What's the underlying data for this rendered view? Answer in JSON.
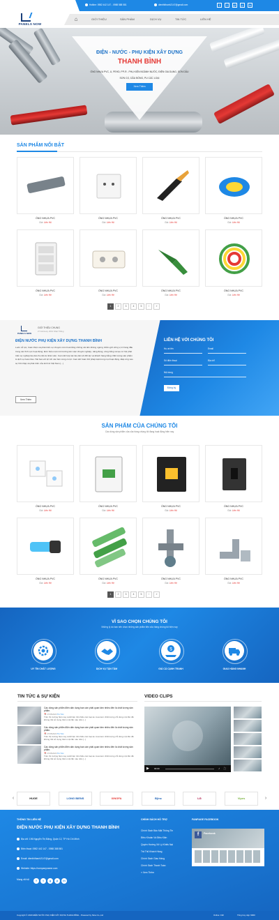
{
  "colors": {
    "accent": "#1e88e5",
    "accent_dark": "#1565c0",
    "price_red": "#e53935",
    "title_red": "#e53935"
  },
  "topbar": {
    "hotline": "Hotline: 0982 442 147 - 0988 588 581",
    "email": "dienthithanh2147@gmail.com",
    "social_icons": [
      "f",
      "t",
      "g+",
      "p",
      "in"
    ]
  },
  "logo": {
    "text": "PANELS NOW"
  },
  "nav": {
    "home_icon": "home-icon",
    "items": [
      "GIỚI THIỆU",
      "SẢN PHẨM",
      "DỊCH VỤ",
      "TIN TỨC",
      "LIÊN HỆ"
    ]
  },
  "banner": {
    "title1": "ĐIỆN - NƯỚC - PHỤ KIỆN XÂY DỰNG",
    "title2": "THANH BÌNH",
    "desc1": "ỐNG NHỰA PVC, U, PEHD, PP-R - PHỤ KIỆN NGÀNH NƯỚC, ĐIỆN GIA DỤNG, SƠN DẦU",
    "desc2": "SƠN CỌ, DẦU BÓNG, PU CÁC LOẠI",
    "button": "Xem Thêm"
  },
  "featured": {
    "title": "SẢN PHẨM NỔI BẬT",
    "products": [
      {
        "name": "ỐNG NHỰA PVC",
        "price_label": "Giá:",
        "price": "Liên Hệ",
        "image": "grey-pvc-pipe"
      },
      {
        "name": "ỐNG NHỰA PVC",
        "price_label": "Giá:",
        "price": "Liên Hệ",
        "image": "wall-socket"
      },
      {
        "name": "ỐNG NHỰA PVC",
        "price_label": "Giá:",
        "price": "Liên Hệ",
        "image": "wire-stripper-tool"
      },
      {
        "name": "ỐNG NHỰA PVC",
        "price_label": "Giá:",
        "price": "Liên Hệ",
        "image": "cable-coil"
      },
      {
        "name": "ỐNG NHỰA PVC",
        "price_label": "Giá:",
        "price": "Liên Hệ",
        "image": "light-switch"
      },
      {
        "name": "ỐNG NHỰA PVC",
        "price_label": "Giá:",
        "price": "Liên Hệ",
        "image": "power-socket-box"
      },
      {
        "name": "ỐNG NHỰA PVC",
        "price_label": "Giá:",
        "price": "Liên Hệ",
        "image": "green-pipe-cutter"
      },
      {
        "name": "ỐNG NHỰA PVC",
        "price_label": "Giá:",
        "price": "Liên Hệ",
        "image": "colored-wire-bundle"
      }
    ],
    "pager": [
      "1",
      "2",
      "3",
      "4",
      "5",
      "›",
      "»"
    ]
  },
  "intro": {
    "subtitle": "GIỚI THIỆU CHUNG",
    "date": "27 February 2019 Nhật Thắng",
    "title": "ĐIỆN NƯỚC PHỤ KIỆN XÂY DỰNG THANH BÌNH",
    "text": "Luôn nỗ lực, hoàn thiện và phát triển sự chuyên môn hoá bằng những cải tiến không ngừng nhằm giữ vững vị trí hàng đầu trong các lĩnh vực hoạt động. Đơn hiểu một môi trường làm việc chuyên nghiệp, năng động, công bằng và tạo cơ hội phát triển sự nghiệp lâu dài cho tất cả nhân viên. Cam kết hợp tác lâu dài với đối tác và khách hàng bằng chất lượng sản phẩm & dịch vụ hoàn hảo. Hài hoà với lợi ích các bên cùng có lợi. Cam kết hoàn thủ pháp luật trong mọi hoạt động. Đáp ứng vào sự hồi nhập và phát triển của kinh tế Việt Nam [...]",
    "button": "Xem Thêm"
  },
  "contact": {
    "title": "LIÊN HỆ VỚI CHÚNG TÔI",
    "fields": [
      {
        "label": "Họ và tên"
      },
      {
        "label": "Email"
      },
      {
        "label": "Số điện thoại"
      },
      {
        "label": "Địa chỉ"
      },
      {
        "label": "Nội dung"
      }
    ],
    "button": "Đăng ký"
  },
  "products": {
    "title": "SẢN PHẨM CỦA CHÚNG TÔI",
    "subtitle": "Các dòng sản phẩm của của hàng chúng tôi đang hoạt động hiện nay",
    "items": [
      {
        "name": "ỐNG NHỰA PVC",
        "price_label": "Giá:",
        "price": "Liên Hệ",
        "image": "touch-switch-panels"
      },
      {
        "name": "ỐNG NHỰA PVC",
        "price_label": "Giá:",
        "price": "Liên Hệ",
        "image": "circuit-breaker"
      },
      {
        "name": "ỐNG NHỰA PVC",
        "price_label": "Giá:",
        "price": "Liên Hệ",
        "image": "mccb-breaker"
      },
      {
        "name": "ỐNG NHỰA PVC",
        "price_label": "Giá:",
        "price": "Liên Hệ",
        "image": "black-switch-box"
      },
      {
        "name": "ỐNG NHỰA PVC",
        "price_label": "Giá:",
        "price": "Liên Hệ",
        "image": "hose-connector"
      },
      {
        "name": "ỐNG NHỰA PVC",
        "price_label": "Giá:",
        "price": "Liên Hệ",
        "image": "green-ppr-pipes"
      },
      {
        "name": "ỐNG NHỰA PVC",
        "price_label": "Giá:",
        "price": "Liên Hệ",
        "image": "grey-pipe-fittings"
      },
      {
        "name": "ỐNG NHỰA PVC",
        "price_label": "Giá:",
        "price": "Liên Hệ",
        "image": "elbow-fittings"
      }
    ],
    "pager": [
      "1",
      "2",
      "3",
      "4",
      "5",
      "›",
      "»"
    ]
  },
  "why": {
    "title": "VÌ SAO CHỌN CHÚNG TÔI",
    "subtitle": "Những lý do bạn nên chọn những sản phẩm tiện của hàng chúng tôi hiện nay",
    "items": [
      {
        "label": "UY TÍN CHẤT LƯỢNG",
        "icon": "quality-gear-icon"
      },
      {
        "label": "DỊCH VỤ TẬN TÂM",
        "icon": "handshake-icon"
      },
      {
        "label": "GIÁ CẢ CẠNH TRANH",
        "icon": "money-hand-icon"
      },
      {
        "label": "GIAO HÀNG NHANH",
        "icon": "delivery-truck-icon"
      }
    ]
  },
  "news": {
    "title": "TIN TỨC & SỰ KIỆN",
    "items": [
      {
        "headline": "Các dòng sản phẩm điện dân dụng bạn cần phải quan tâm nhiều đến là chất lượng sản phẩm.",
        "date": "27/05/2020",
        "tag": "Tin Tức",
        "excerpt": "Trên thị trường hiện nay xuất hiện rất nhiều các loại ào mua kém chất lượng chỉ dùng một lần đã không thể sử dụng thêm một lần nào nữa [...]"
      },
      {
        "headline": "Các dòng sản phẩm điện dân dụng bạn cần phải quan tâm nhiều đến là chất lượng sản phẩm.",
        "date": "27/05/2020",
        "tag": "Tin Tức",
        "excerpt": "Trên thị trường hiện nay xuất hiện rất nhiều các loại ào mua kém chất lượng chỉ dùng một lần đã không thể sử dụng thêm một lần nào nữa [...]"
      },
      {
        "headline": "Các dòng sản phẩm điện dân dụng bạn cần phải quan tâm nhiều đến là chất lượng sản phẩm.",
        "date": "27/05/2020",
        "tag": "Tin Tức",
        "excerpt": "Trên thị trường hiện nay xuất hiện rất nhiều các loại ào mua kém chất lượng chỉ dùng một lần đã không thể sử dụng thêm một lần nào nữa [...]"
      }
    ]
  },
  "video": {
    "title": "VIDEO CLIPS",
    "time": "00:00"
  },
  "partners": {
    "logos": [
      {
        "name": "HUGE",
        "color": "#222222"
      },
      {
        "name": "LONG BIENS",
        "color": "#1a5fb4"
      },
      {
        "name": "XINGFA",
        "color": "#e53935"
      },
      {
        "name": "B(inc",
        "color": "#1a5fb4"
      },
      {
        "name": "LG",
        "color": "#a50034"
      },
      {
        "name": "Vipes",
        "color": "#7cb342"
      }
    ]
  },
  "footer": {
    "contact_sub": "THÔNG TIN LIÊN HỆ",
    "company": "ĐIỆN NƯỚC PHỤ KIỆN XÂY DỰNG THANH BÌNH",
    "address": "Địa chỉ: 196 Nguyễn Thị Đặng, Quận 12, TP Hồ Chí Minh",
    "phone": "Điện thoại: 0982 442 147 - 0988 388 581",
    "email": "Email: dienthithanh2147@gmail.com",
    "website": "Website: https://companyname.com",
    "social_label": "Mạng xã hội",
    "social_icons": [
      "f",
      "t",
      "g",
      "p",
      "in"
    ],
    "policy_sub": "CHÍNH SÁCH HỖ TRỢ",
    "links": [
      "Chính Sách Bảo Mật Thông Tin",
      "Điều Khoản Và Điều Kiện",
      "Quyền Hướng Xử Lý Khiếu Nại",
      "Trả Thủ Khách Hàng",
      "Chính Sách Giao Hàng",
      "Chính Sách Thanh Toán",
      "» Xem Thêm"
    ],
    "fanpage_sub": "FANPAGE FACEBOOK",
    "fb_name": "Facebook",
    "copyright": "Copyright © 2020 ĐIỆN NƯỚC PHỤ KIỆN XÂY DỰNG THANH BÌNH - Powered by Nina Co.,Ltd",
    "online": "Online: 190",
    "total": "Tổng truy cập: 9000"
  }
}
